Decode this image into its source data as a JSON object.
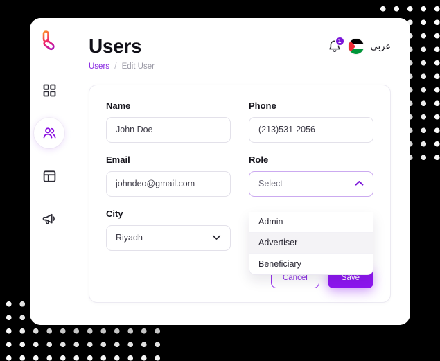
{
  "theme": {
    "accent": "#8a2be2",
    "accent_solid": "#8d16ef",
    "badge": "#7b16d9",
    "text_dark": "#15141c",
    "text_muted": "#9b9aa6",
    "page_bg": "#000000",
    "card_bg": "#ffffff"
  },
  "sidebar": {
    "logo_name": "brand-logo",
    "items": [
      {
        "icon": "grid-dashboard-icon",
        "name": "dashboard",
        "active": false
      },
      {
        "icon": "users-icon",
        "name": "users",
        "active": true
      },
      {
        "icon": "layout-panel-icon",
        "name": "layout",
        "active": false
      },
      {
        "icon": "megaphone-icon",
        "name": "campaigns",
        "active": false
      }
    ]
  },
  "header": {
    "title": "Users",
    "breadcrumb": {
      "root": "Users",
      "separator": "/",
      "current": "Edit User"
    },
    "notification": {
      "icon": "bell-icon",
      "count": "1"
    },
    "flag": {
      "icon": "palestine-flag-icon",
      "colors": {
        "top": "#000000",
        "middle": "#ffffff",
        "bottom": "#009639",
        "triangle": "#ee2a35"
      }
    },
    "language_label": "عربي"
  },
  "form": {
    "fields": {
      "name": {
        "label": "Name",
        "value": "John Doe",
        "placeholder": "Name"
      },
      "phone": {
        "label": "Phone",
        "value": "(213)531-2056",
        "placeholder": "Phone"
      },
      "email": {
        "label": "Email",
        "value": "johndeo@gmail.com",
        "placeholder": "Email"
      },
      "role": {
        "label": "Role",
        "selected": "Select",
        "expanded": true,
        "chevron": "chevron-up-icon",
        "options": [
          {
            "label": "Admin",
            "highlighted": false
          },
          {
            "label": "Advertiser",
            "highlighted": true
          },
          {
            "label": "Beneficiary",
            "highlighted": false
          }
        ]
      },
      "city": {
        "label": "City",
        "selected": "Riyadh",
        "expanded": false,
        "chevron": "chevron-down-icon"
      }
    },
    "actions": {
      "cancel_label": "Cancel",
      "save_label": "Save"
    }
  },
  "decor": {
    "top_right_dots": "dot-grid-pattern",
    "bottom_left_dots": "dot-grid-pattern"
  }
}
